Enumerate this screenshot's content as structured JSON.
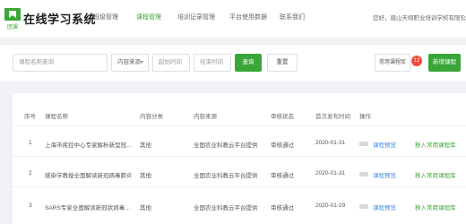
{
  "header": {
    "brand": "在线学习系统",
    "logo_text": "团课",
    "nav": [
      "班级管理",
      "课程管理",
      "培训记录管理",
      "平台使用数据",
      "联系我们"
    ],
    "active_nav": 1,
    "user_greeting": "您好，眉山天翊职业培训学校有限公司"
  },
  "filters": {
    "course_name_placeholder": "课程名称查询",
    "source_select": "内容来源",
    "start_time_placeholder": "起始时间",
    "end_time_placeholder": "结束时间",
    "query_label": "查询",
    "reset_label": "重置",
    "common_courses_label": "常用课程库",
    "common_courses_count": "12",
    "add_course_label": "新增课程"
  },
  "table": {
    "headers": [
      "序号",
      "课程名称",
      "内容分类",
      "内容来源",
      "审核状态",
      "首次发布时间",
      "操作"
    ],
    "rows": [
      {
        "index": "1",
        "name": "上海市疾控中心专家解析新型冠状病毒肺炎",
        "category": "其他",
        "source": "全国农业科教云平台提供",
        "status": "审核通过",
        "date": "2020-01-31",
        "preview": "课程预览",
        "move": "移入常用课程库"
      },
      {
        "index": "2",
        "name": "感染学教授全面解读新冠病毒肺炎",
        "category": "其他",
        "source": "全国农业科教云平台提供",
        "status": "审核通过",
        "date": "2020-01-31",
        "preview": "课程预览",
        "move": "移入常用课程库"
      },
      {
        "index": "3",
        "name": "SARS专家全面解读新冠状病毒肺炎",
        "category": "其他",
        "source": "全国农业科教云平台提供",
        "status": "审核通过",
        "date": "2020-01-29",
        "preview": "课程预览",
        "move": "移入常用课程库"
      }
    ]
  },
  "colors": {
    "accent": "#3aa639",
    "link": "#3a8ee6",
    "badge": "#f0493d"
  }
}
